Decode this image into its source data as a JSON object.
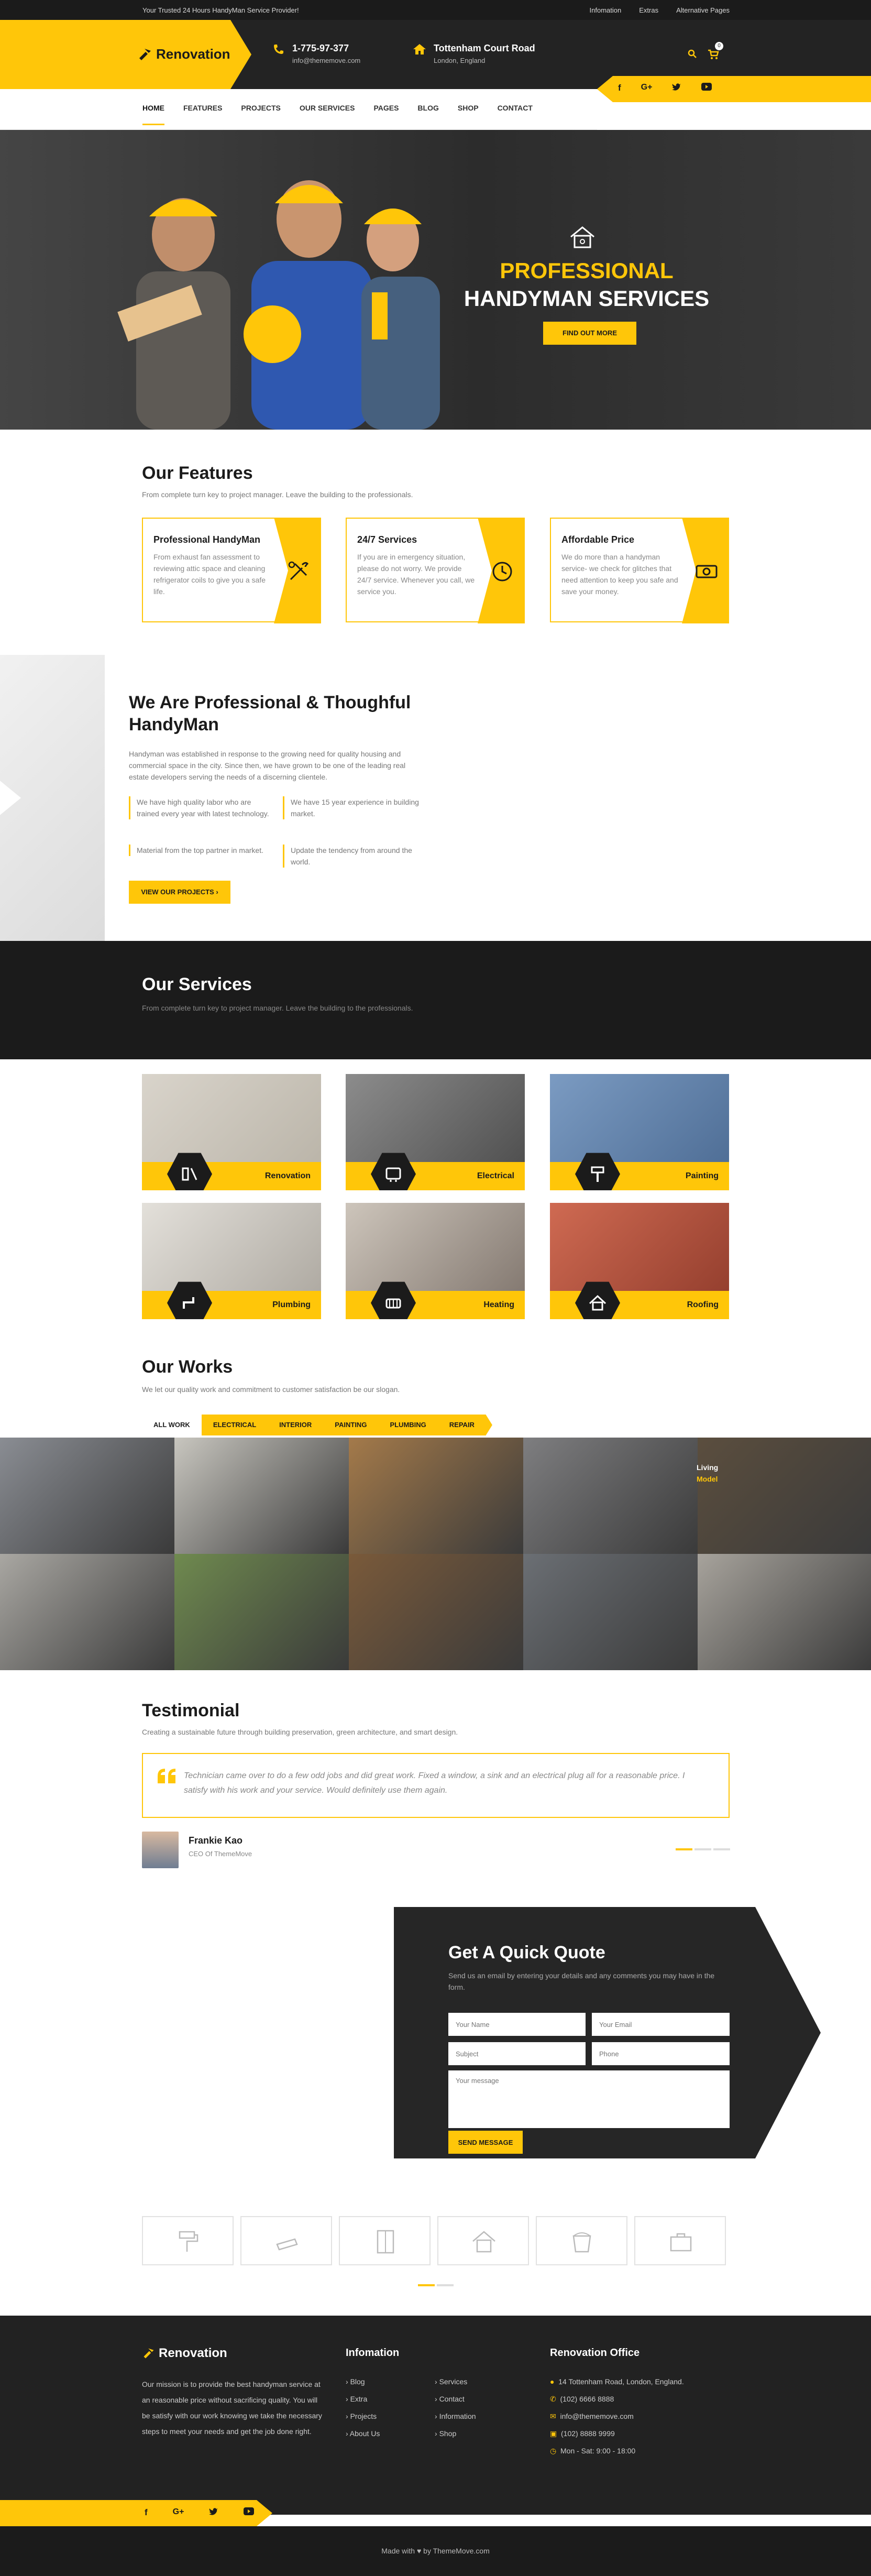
{
  "topbar": {
    "tagline": "Your Trusted 24 Hours HandyMan Service Provider!",
    "links": [
      "Infomation",
      "Extras",
      "Alternative Pages"
    ]
  },
  "header": {
    "logo": "Renovation",
    "phone": "1-775-97-377",
    "email": "info@thememove.com",
    "address_title": "Tottenham Court Road",
    "address_sub": "London, England",
    "cart_count": "0"
  },
  "nav": [
    "HOME",
    "FEATURES",
    "PROJECTS",
    "OUR SERVICES",
    "PAGES",
    "BLOG",
    "SHOP",
    "CONTACT"
  ],
  "hero": {
    "title_1": "PROFESSIONAL",
    "title_2": "HANDYMAN SERVICES",
    "button": "FIND OUT MORE"
  },
  "features": {
    "title": "Our Features",
    "subtitle": "From complete turn key to project manager. Leave the building to the professionals.",
    "items": [
      {
        "title": "Professional HandyMan",
        "text": "From exhaust fan assessment to reviewing attic space and cleaning refrigerator coils to give you a safe life.",
        "icon": "tools-icon"
      },
      {
        "title": "24/7 Services",
        "text": "If you are in emergency situation, please do not worry. We provide 24/7 service. Whenever you call, we service you.",
        "icon": "clock-icon"
      },
      {
        "title": "Affordable Price",
        "text": "We do more than a handyman service- we check for glitches that need attention to keep you safe and save your money.",
        "icon": "money-icon"
      }
    ]
  },
  "about": {
    "title": "We Are Professional & Thoughful HandyMan",
    "text": "Handyman was established in response to the growing need for quality housing and commercial space in the city. Since then, we have grown to be one of the leading real estate developers serving the needs of a discerning clientele.",
    "bullets": [
      "We have high quality labor who are trained every year with latest technology.",
      "We have 15 year experience in building market.",
      "Material from the top partner in market.",
      "Update the tendency from around the world."
    ],
    "button": "VIEW OUR PROJECTS ›"
  },
  "services": {
    "title": "Our Services",
    "subtitle": "From complete turn key to project manager. Leave the building to the professionals.",
    "items": [
      {
        "label": "Renovation",
        "icon": "renovation-icon",
        "photo": "#b8b2a6"
      },
      {
        "label": "Electrical",
        "icon": "electrical-icon",
        "photo": "#6d6d6d"
      },
      {
        "label": "Painting",
        "icon": "painting-icon",
        "photo": "#5f7fa6"
      },
      {
        "label": "Plumbing",
        "icon": "plumbing-icon",
        "photo": "#c7c3bc"
      },
      {
        "label": "Heating",
        "icon": "heating-icon",
        "photo": "#9a8f86"
      },
      {
        "label": "Roofing",
        "icon": "roofing-icon",
        "photo": "#b0503c"
      }
    ]
  },
  "works": {
    "title": "Our Works",
    "subtitle": "We let our quality work and commitment to customer satisfaction be our slogan.",
    "filters": [
      "ALL WORK",
      "ELECTRICAL",
      "INTERIOR",
      "PAINTING",
      "PLUMBING",
      "REPAIR"
    ],
    "overlay_text": [
      "Living",
      "Model"
    ],
    "photos": [
      "#8a8d93",
      "#c8c6bf",
      "#a47a4a",
      "#7e7e80",
      "#5b4e3e",
      "#a9a7a2",
      "#6f8a4f",
      "#7a5a3a",
      "#6b6f74",
      "#a7a39c"
    ]
  },
  "testimonial": {
    "title": "Testimonial",
    "subtitle": "Creating a sustainable future through building preservation, green architecture, and smart design.",
    "quote": "Technician came over to do a few odd jobs and did great work. Fixed a window, a sink and an electrical plug all for a reasonable price. I satisfy with his work and your service. Would definitely use them again.",
    "name": "Frankie Kao",
    "role": "CEO Of ThemeMove"
  },
  "quote": {
    "title": "Get A Quick Quote",
    "subtitle": "Send us an email by entering your details and any comments you may have in the form.",
    "fields": {
      "name": "Your Name",
      "email": "Your Email",
      "subject": "Subject",
      "phone": "Phone",
      "message": "Your message"
    },
    "button": "SEND MESSAGE"
  },
  "clients": [
    "paint-roller-icon",
    "saw-icon",
    "door-icon",
    "house-icon",
    "paint-bucket-icon",
    "toolbox-icon"
  ],
  "footer": {
    "logo": "Renovation",
    "about": "Our mission is to provide the best handyman service at an reasonable price without sacrificing quality. You will be satisfy with our work knowing we take the necessary steps to meet your needs and get the job done right.",
    "info_title": "Infomation",
    "links_left": [
      "Blog",
      "Extra",
      "Projects",
      "About Us"
    ],
    "links_right": [
      "Services",
      "Contact",
      "Information",
      "Shop"
    ],
    "office_title": "Renovation Office",
    "office": [
      "14 Tottenham Road, London, England.",
      "(102) 6666 8888",
      "info@thememove.com",
      "(102) 8888 9999",
      "Mon - Sat: 9:00 - 18:00"
    ],
    "credit": "Made with ♥ by ThemeMove.com"
  },
  "colors": {
    "accent": "#ffc609",
    "dark": "#1b1b1b",
    "header": "#232323"
  }
}
